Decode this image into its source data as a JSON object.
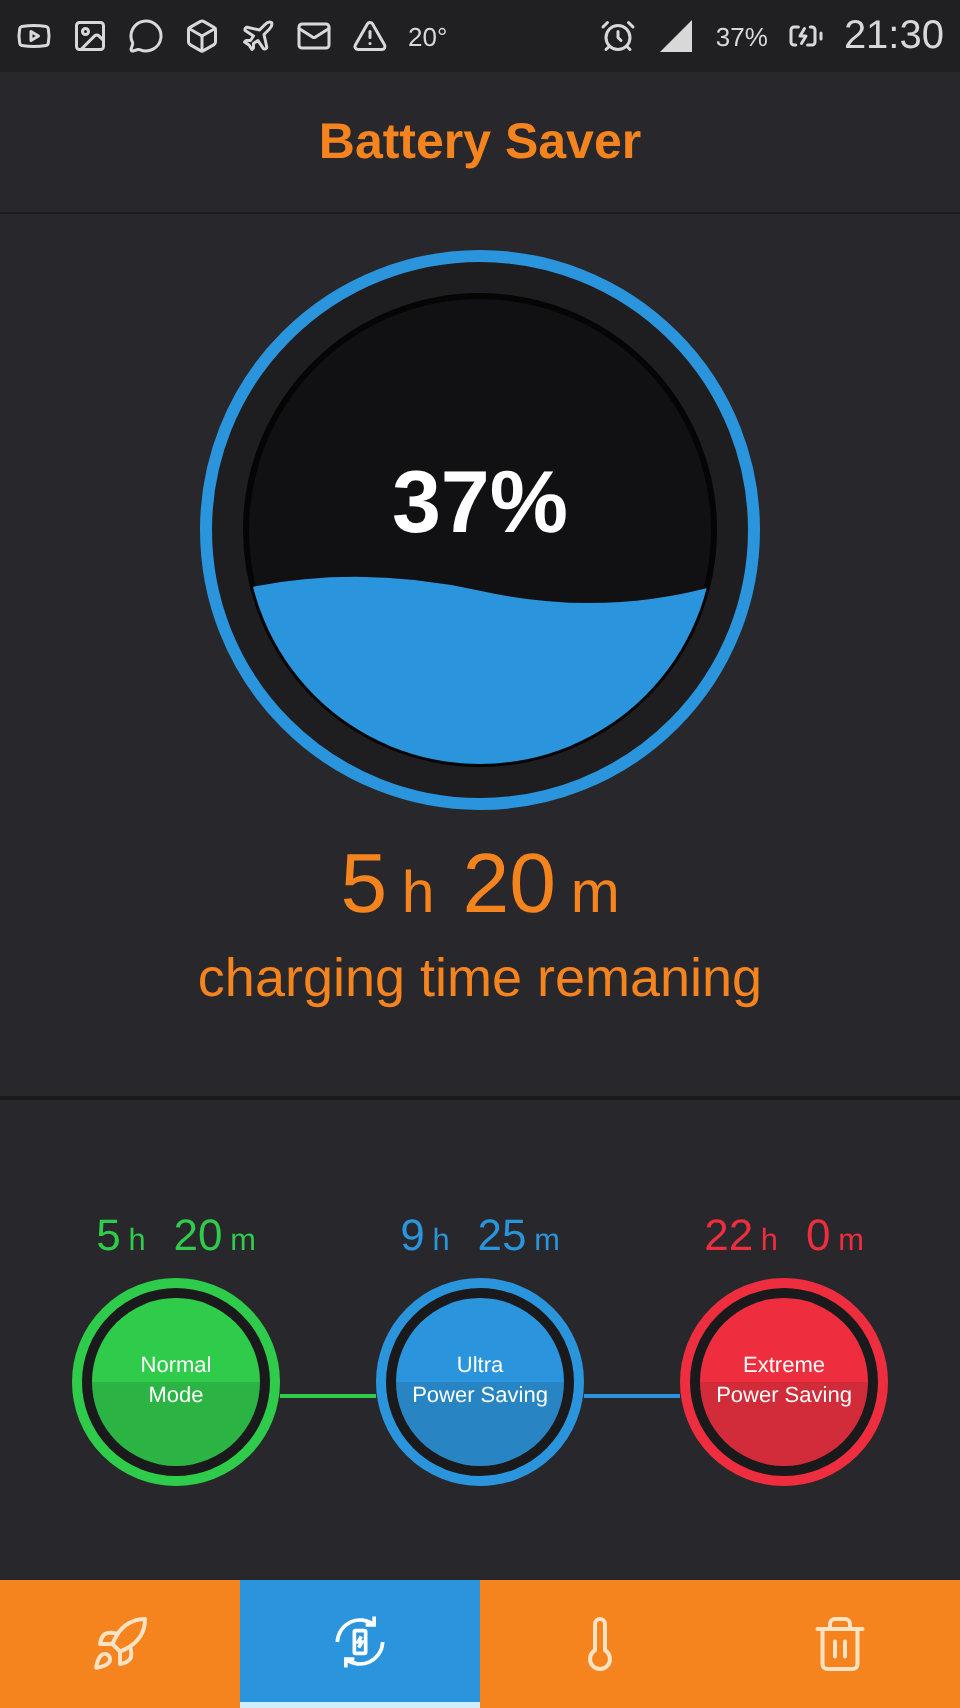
{
  "status_bar": {
    "temperature": "20°",
    "battery": "37%",
    "time": "21:30"
  },
  "title": "Battery Saver",
  "gauge": {
    "percent": "37%"
  },
  "remaining": {
    "parts": [
      {
        "value": "5",
        "unit": "h"
      },
      {
        "value": "20",
        "unit": "m"
      }
    ],
    "label": "charging time remaning"
  },
  "modes": [
    {
      "parts": [
        {
          "value": "5",
          "unit": "h"
        },
        {
          "value": "20",
          "unit": "m"
        }
      ],
      "label_lines": [
        "Normal",
        "Mode"
      ],
      "color": "#2ecc4a"
    },
    {
      "parts": [
        {
          "value": "9",
          "unit": "h"
        },
        {
          "value": "25",
          "unit": "m"
        }
      ],
      "label_lines": [
        "Ultra",
        "Power Saving"
      ],
      "color": "#2a95dc"
    },
    {
      "parts": [
        {
          "value": "22",
          "unit": "h"
        },
        {
          "value": "0",
          "unit": "m"
        }
      ],
      "label_lines": [
        "Extreme",
        "Power Saving"
      ],
      "color": "#ee2e3e"
    }
  ],
  "nav": [
    {
      "kind": "boost",
      "selected": false
    },
    {
      "kind": "charge",
      "selected": true
    },
    {
      "kind": "cool",
      "selected": false
    },
    {
      "kind": "clean",
      "selected": false
    }
  ]
}
